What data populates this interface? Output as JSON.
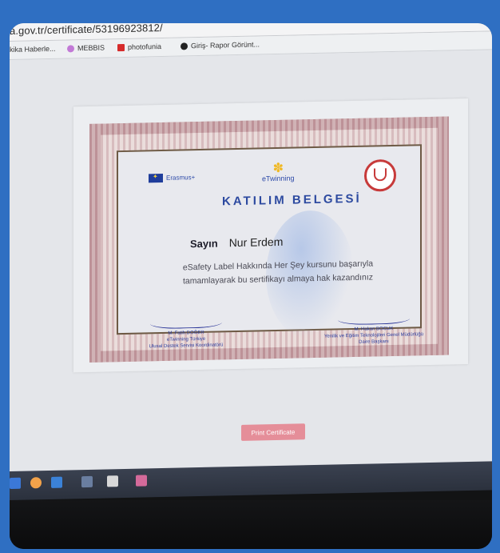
{
  "browser": {
    "url": "a.gov.tr/certificate/53196923812/",
    "bookmarks": [
      "kika Haberle...",
      "MEBBIS",
      "photofunia",
      "Giriş- Rapor Görünt..."
    ]
  },
  "certificate": {
    "program": "Erasmus+",
    "brand": "eTwinning",
    "title": "KATILIM BELGESİ",
    "salutation": "Sayın",
    "recipient": "Nur Erdem",
    "body_line1": "eSafety Label Hakkında Her Şey kursunu başarıyla",
    "body_line2": "tamamlayarak bu sertifikayı almaya hak kazandınız",
    "signer_left": {
      "name": "M. Fatih DOĞER",
      "role1": "eTwinning Türkiye",
      "role2": "Ulusal Destek Servisi Koordinatörü"
    },
    "signer_right": {
      "name": "M. Hakan BOCUK",
      "role1": "Yenilik ve Eğitim Teknolojileri Genel Müdürlüğü",
      "role2": "Daire Başkanı"
    }
  },
  "actions": {
    "print_label": "Print Certificate"
  },
  "colors": {
    "frame_blue": "#2f6fc2",
    "title_blue": "#2d4aa0",
    "button_pink": "#e58e99"
  }
}
